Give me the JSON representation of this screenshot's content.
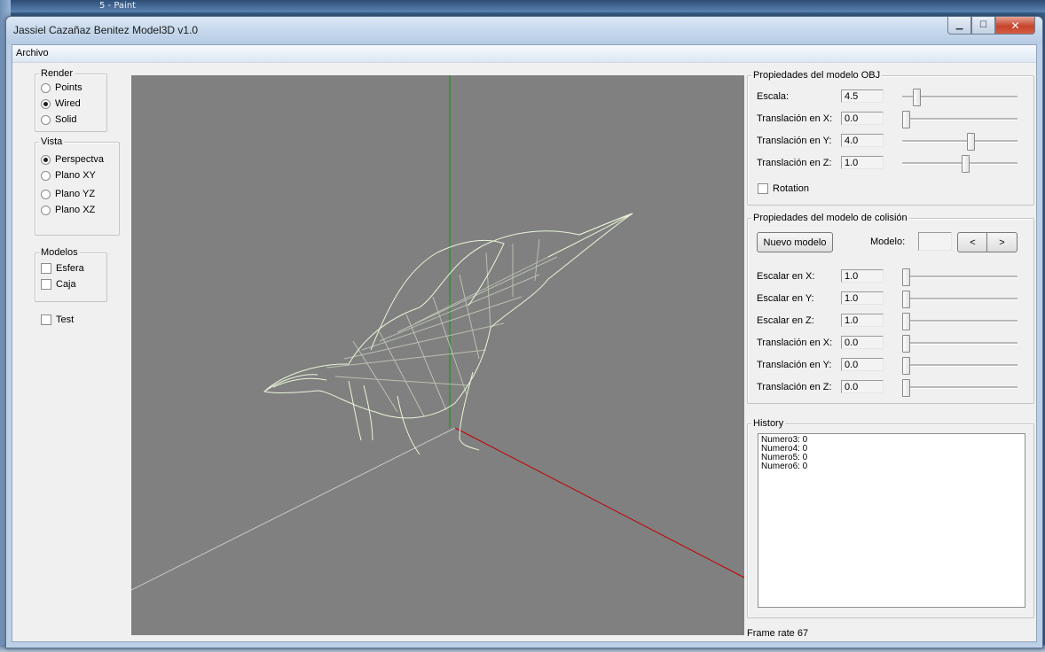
{
  "window": {
    "title": "Jassiel Cazañaz Benitez Model3D v1.0",
    "background_title": "5 - Paint"
  },
  "menu": {
    "items": [
      "Archivo"
    ]
  },
  "render_group": {
    "label": "Render",
    "options": [
      {
        "label": "Points",
        "selected": false
      },
      {
        "label": "Wired",
        "selected": true
      },
      {
        "label": "Solid",
        "selected": false
      }
    ]
  },
  "vista_group": {
    "label": "Vista",
    "options": [
      {
        "label": "Perspectva",
        "selected": true
      },
      {
        "label": "Plano XY",
        "selected": false
      },
      {
        "label": "Plano YZ",
        "selected": false
      },
      {
        "label": "Plano XZ",
        "selected": false
      }
    ]
  },
  "modelos_group": {
    "label": "Modelos",
    "options": [
      {
        "label": "Esfera",
        "checked": false
      },
      {
        "label": "Caja",
        "checked": false
      }
    ]
  },
  "test_checkbox": {
    "label": "Test",
    "checked": false
  },
  "obj_props": {
    "label": "Propiedades del modelo OBJ",
    "fields": [
      {
        "label": "Escala:",
        "value": "4.5",
        "slider": 0.1
      },
      {
        "label": "Translación en X:",
        "value": "0.0",
        "slider": 0.0
      },
      {
        "label": "Translación en Y:",
        "value": "4.0",
        "slider": 0.6
      },
      {
        "label": "Translación en Z:",
        "value": "1.0",
        "slider": 0.55
      }
    ],
    "rotation": {
      "label": "Rotation",
      "checked": false
    }
  },
  "collision_props": {
    "label": "Propiedades del modelo de colisión",
    "new_model_button": "Nuevo modelo",
    "model_label": "Modelo:",
    "model_value": "",
    "prev_button": "<",
    "next_button": ">",
    "fields": [
      {
        "label": "Escalar en X:",
        "value": "1.0",
        "slider": 0.0
      },
      {
        "label": "Escalar en Y:",
        "value": "1.0",
        "slider": 0.0
      },
      {
        "label": "Escalar en Z:",
        "value": "1.0",
        "slider": 0.0
      },
      {
        "label": "Translación en X:",
        "value": "0.0",
        "slider": 0.0
      },
      {
        "label": "Translación en Y:",
        "value": "0.0",
        "slider": 0.0
      },
      {
        "label": "Translación en Z:",
        "value": "0.0",
        "slider": 0.0
      }
    ]
  },
  "history": {
    "label": "History",
    "lines": [
      "Numero3: 0",
      "Numero4: 0",
      "Numero5: 0",
      "Numero6: 0"
    ]
  },
  "status": {
    "frame_rate": "Frame rate 67"
  },
  "colors": {
    "viewport_bg": "#808080",
    "axis_x": "#c00000",
    "axis_y": "#00a000",
    "axis_z": "#c8c8c8",
    "wireframe": "#e8f5d8"
  }
}
